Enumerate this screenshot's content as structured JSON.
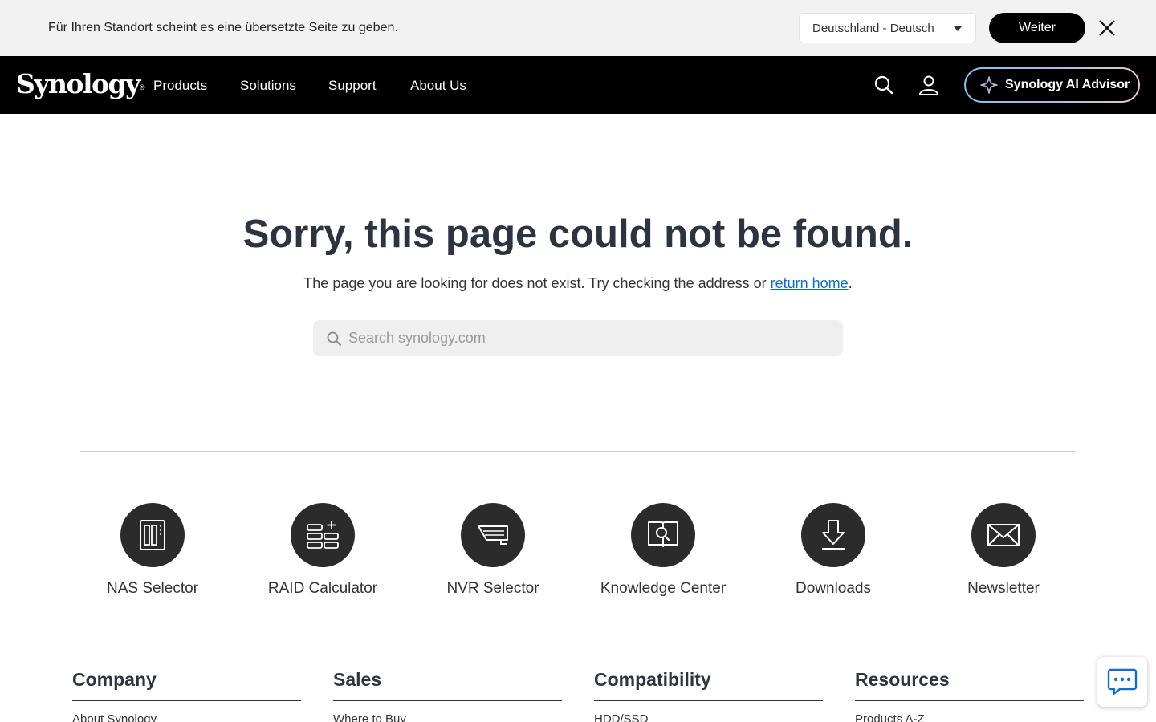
{
  "locale_banner": {
    "message": "Für Ihren Standort scheint es eine übersetzte Seite zu geben.",
    "selected_locale": "Deutschland - Deutsch",
    "continue_label": "Weiter"
  },
  "nav": {
    "logo_text": "Synology",
    "logo_mark": "®",
    "items": [
      {
        "label": "Products"
      },
      {
        "label": "Solutions"
      },
      {
        "label": "Support"
      },
      {
        "label": "About Us"
      }
    ],
    "ai_advisor_label": "Synology AI Advisor"
  },
  "main": {
    "title": "Sorry, this page could not be found.",
    "subtitle_prefix": "The page you are looking for does not exist. Try checking the address or ",
    "return_home_label": "return home",
    "subtitle_suffix": ".",
    "search_placeholder": "Search synology.com"
  },
  "tools": [
    {
      "label": "NAS Selector",
      "icon": "nas-icon"
    },
    {
      "label": "RAID Calculator",
      "icon": "raid-calculator-icon"
    },
    {
      "label": "NVR Selector",
      "icon": "nvr-icon"
    },
    {
      "label": "Knowledge Center",
      "icon": "knowledge-center-icon"
    },
    {
      "label": "Downloads",
      "icon": "download-icon"
    },
    {
      "label": "Newsletter",
      "icon": "envelope-icon"
    }
  ],
  "footer": {
    "columns": [
      {
        "title": "Company",
        "first_link": "About Synology"
      },
      {
        "title": "Sales",
        "first_link": "Where to Buy"
      },
      {
        "title": "Compatibility",
        "first_link": "HDD/SSD"
      },
      {
        "title": "Resources",
        "first_link": "Products A-Z"
      }
    ]
  },
  "colors": {
    "nav_background": "#000000",
    "banner_background": "#f2f2f2",
    "link": "#0b6bcb",
    "heading": "#2b3440",
    "tool_circle": "#2b2b2b"
  }
}
